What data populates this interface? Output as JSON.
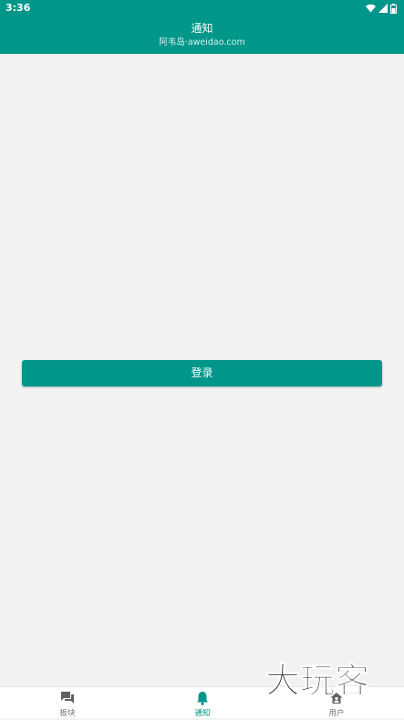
{
  "status_bar": {
    "time": "3:36",
    "icons": [
      "wifi-icon",
      "signal-icon",
      "battery-icon"
    ]
  },
  "app_bar": {
    "title": "通知",
    "subtitle": "阿韦岛·aweidao.com"
  },
  "main": {
    "login_label": "登录"
  },
  "bottom_nav": {
    "items": [
      {
        "label": "板块",
        "icon": "forum-icon",
        "active": false
      },
      {
        "label": "通知",
        "icon": "bell-icon",
        "active": true
      },
      {
        "label": "用户",
        "icon": "user-home-icon",
        "active": false
      }
    ]
  },
  "watermark": {
    "text": "大玩客"
  },
  "colors": {
    "primary": "#00968a",
    "background": "#f2f2f2",
    "nav_inactive": "#757575"
  }
}
